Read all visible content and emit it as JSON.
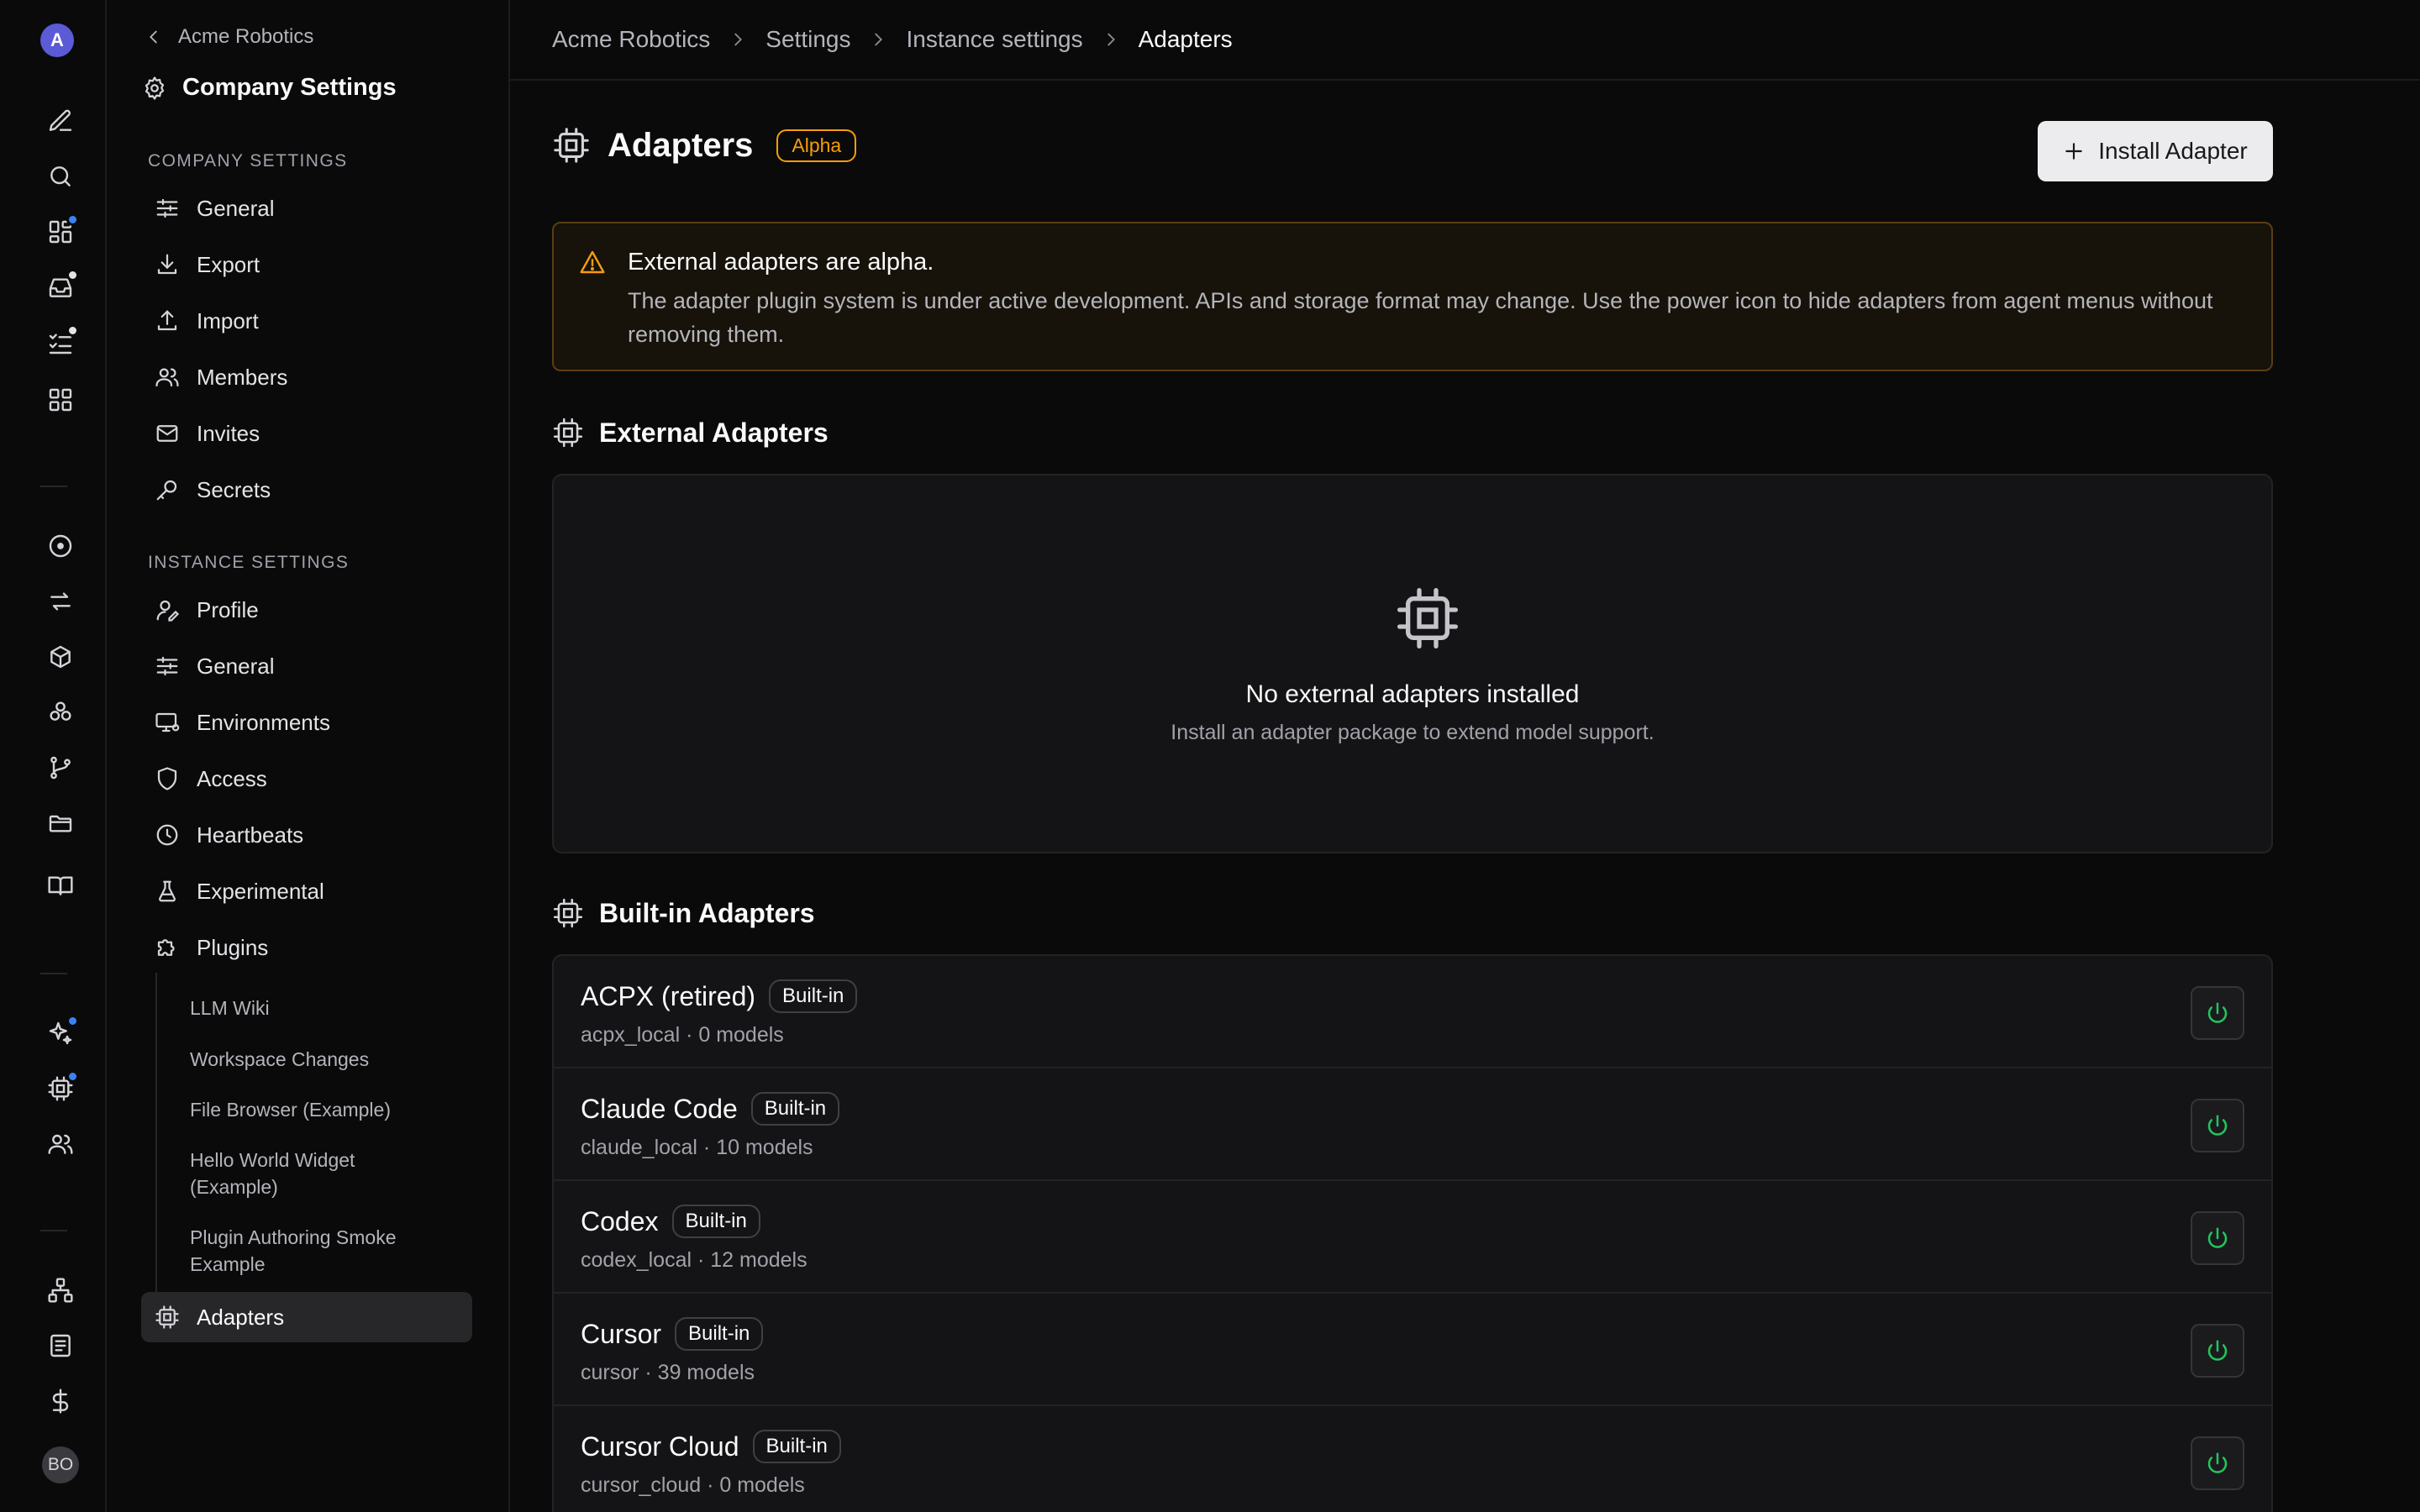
{
  "rail": {
    "logo_letter": "A",
    "user_initials": "BO",
    "dot_color": "#3b82f6",
    "dot_white": "#e4e4e7",
    "accent": "#5b5bd6"
  },
  "sidebar": {
    "back_label": "Acme Robotics",
    "title": "Company Settings",
    "company_section": "Company Settings",
    "company_items": [
      {
        "label": "General",
        "icon": "sliders-icon"
      },
      {
        "label": "Export",
        "icon": "download-icon"
      },
      {
        "label": "Import",
        "icon": "upload-icon"
      },
      {
        "label": "Members",
        "icon": "users-icon"
      },
      {
        "label": "Invites",
        "icon": "mail-icon"
      },
      {
        "label": "Secrets",
        "icon": "key-icon"
      }
    ],
    "instance_section": "Instance Settings",
    "instance_items": [
      {
        "label": "Profile",
        "icon": "user-pen-icon"
      },
      {
        "label": "General",
        "icon": "sliders-icon"
      },
      {
        "label": "Environments",
        "icon": "monitor-icon"
      },
      {
        "label": "Access",
        "icon": "shield-icon"
      },
      {
        "label": "Heartbeats",
        "icon": "clock-icon"
      },
      {
        "label": "Experimental",
        "icon": "flask-icon"
      },
      {
        "label": "Plugins",
        "icon": "puzzle-icon"
      }
    ],
    "plugin_items": [
      "LLM Wiki",
      "Workspace Changes",
      "File Browser (Example)",
      "Hello World Widget (Example)",
      "Plugin Authoring Smoke Example"
    ],
    "active_item": "Adapters"
  },
  "breadcrumb": [
    "Acme Robotics",
    "Settings",
    "Instance settings",
    "Adapters"
  ],
  "page": {
    "title": "Adapters",
    "badge": "Alpha",
    "install_button": "Install Adapter",
    "warning_color": "#f59e0b"
  },
  "alert": {
    "title": "External adapters are alpha.",
    "body": "The adapter plugin system is under active development. APIs and storage format may change. Use the power icon to hide adapters from agent menus without removing them."
  },
  "external": {
    "heading": "External Adapters",
    "empty_title": "No external adapters installed",
    "empty_subtitle": "Install an adapter package to extend model support."
  },
  "builtin": {
    "heading": "Built-in Adapters",
    "badge": "Built-in",
    "power_color": "#22c55e",
    "adapters": [
      {
        "name": "ACPX (retired)",
        "meta": "acpx_local · 0 models"
      },
      {
        "name": "Claude Code",
        "meta": "claude_local · 10 models"
      },
      {
        "name": "Codex",
        "meta": "codex_local · 12 models"
      },
      {
        "name": "Cursor",
        "meta": "cursor · 39 models"
      },
      {
        "name": "Cursor Cloud",
        "meta": "cursor_cloud · 0 models"
      }
    ]
  }
}
